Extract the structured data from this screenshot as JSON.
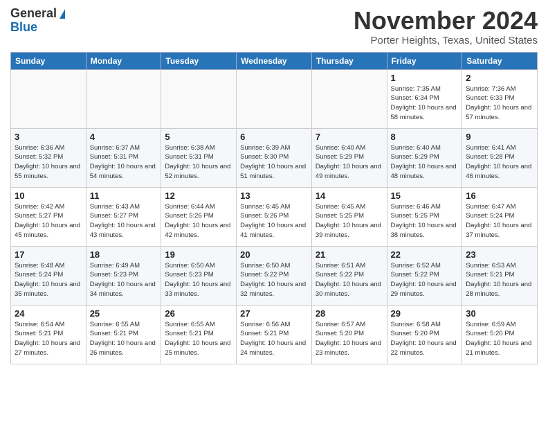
{
  "logo": {
    "general": "General",
    "blue": "Blue"
  },
  "header": {
    "month": "November 2024",
    "location": "Porter Heights, Texas, United States"
  },
  "weekdays": [
    "Sunday",
    "Monday",
    "Tuesday",
    "Wednesday",
    "Thursday",
    "Friday",
    "Saturday"
  ],
  "weeks": [
    [
      {
        "day": "",
        "info": ""
      },
      {
        "day": "",
        "info": ""
      },
      {
        "day": "",
        "info": ""
      },
      {
        "day": "",
        "info": ""
      },
      {
        "day": "",
        "info": ""
      },
      {
        "day": "1",
        "info": "Sunrise: 7:35 AM\nSunset: 6:34 PM\nDaylight: 10 hours and 58 minutes."
      },
      {
        "day": "2",
        "info": "Sunrise: 7:36 AM\nSunset: 6:33 PM\nDaylight: 10 hours and 57 minutes."
      }
    ],
    [
      {
        "day": "3",
        "info": "Sunrise: 6:36 AM\nSunset: 5:32 PM\nDaylight: 10 hours and 55 minutes."
      },
      {
        "day": "4",
        "info": "Sunrise: 6:37 AM\nSunset: 5:31 PM\nDaylight: 10 hours and 54 minutes."
      },
      {
        "day": "5",
        "info": "Sunrise: 6:38 AM\nSunset: 5:31 PM\nDaylight: 10 hours and 52 minutes."
      },
      {
        "day": "6",
        "info": "Sunrise: 6:39 AM\nSunset: 5:30 PM\nDaylight: 10 hours and 51 minutes."
      },
      {
        "day": "7",
        "info": "Sunrise: 6:40 AM\nSunset: 5:29 PM\nDaylight: 10 hours and 49 minutes."
      },
      {
        "day": "8",
        "info": "Sunrise: 6:40 AM\nSunset: 5:29 PM\nDaylight: 10 hours and 48 minutes."
      },
      {
        "day": "9",
        "info": "Sunrise: 6:41 AM\nSunset: 5:28 PM\nDaylight: 10 hours and 46 minutes."
      }
    ],
    [
      {
        "day": "10",
        "info": "Sunrise: 6:42 AM\nSunset: 5:27 PM\nDaylight: 10 hours and 45 minutes."
      },
      {
        "day": "11",
        "info": "Sunrise: 6:43 AM\nSunset: 5:27 PM\nDaylight: 10 hours and 43 minutes."
      },
      {
        "day": "12",
        "info": "Sunrise: 6:44 AM\nSunset: 5:26 PM\nDaylight: 10 hours and 42 minutes."
      },
      {
        "day": "13",
        "info": "Sunrise: 6:45 AM\nSunset: 5:26 PM\nDaylight: 10 hours and 41 minutes."
      },
      {
        "day": "14",
        "info": "Sunrise: 6:45 AM\nSunset: 5:25 PM\nDaylight: 10 hours and 39 minutes."
      },
      {
        "day": "15",
        "info": "Sunrise: 6:46 AM\nSunset: 5:25 PM\nDaylight: 10 hours and 38 minutes."
      },
      {
        "day": "16",
        "info": "Sunrise: 6:47 AM\nSunset: 5:24 PM\nDaylight: 10 hours and 37 minutes."
      }
    ],
    [
      {
        "day": "17",
        "info": "Sunrise: 6:48 AM\nSunset: 5:24 PM\nDaylight: 10 hours and 35 minutes."
      },
      {
        "day": "18",
        "info": "Sunrise: 6:49 AM\nSunset: 5:23 PM\nDaylight: 10 hours and 34 minutes."
      },
      {
        "day": "19",
        "info": "Sunrise: 6:50 AM\nSunset: 5:23 PM\nDaylight: 10 hours and 33 minutes."
      },
      {
        "day": "20",
        "info": "Sunrise: 6:50 AM\nSunset: 5:22 PM\nDaylight: 10 hours and 32 minutes."
      },
      {
        "day": "21",
        "info": "Sunrise: 6:51 AM\nSunset: 5:22 PM\nDaylight: 10 hours and 30 minutes."
      },
      {
        "day": "22",
        "info": "Sunrise: 6:52 AM\nSunset: 5:22 PM\nDaylight: 10 hours and 29 minutes."
      },
      {
        "day": "23",
        "info": "Sunrise: 6:53 AM\nSunset: 5:21 PM\nDaylight: 10 hours and 28 minutes."
      }
    ],
    [
      {
        "day": "24",
        "info": "Sunrise: 6:54 AM\nSunset: 5:21 PM\nDaylight: 10 hours and 27 minutes."
      },
      {
        "day": "25",
        "info": "Sunrise: 6:55 AM\nSunset: 5:21 PM\nDaylight: 10 hours and 26 minutes."
      },
      {
        "day": "26",
        "info": "Sunrise: 6:55 AM\nSunset: 5:21 PM\nDaylight: 10 hours and 25 minutes."
      },
      {
        "day": "27",
        "info": "Sunrise: 6:56 AM\nSunset: 5:21 PM\nDaylight: 10 hours and 24 minutes."
      },
      {
        "day": "28",
        "info": "Sunrise: 6:57 AM\nSunset: 5:20 PM\nDaylight: 10 hours and 23 minutes."
      },
      {
        "day": "29",
        "info": "Sunrise: 6:58 AM\nSunset: 5:20 PM\nDaylight: 10 hours and 22 minutes."
      },
      {
        "day": "30",
        "info": "Sunrise: 6:59 AM\nSunset: 5:20 PM\nDaylight: 10 hours and 21 minutes."
      }
    ]
  ]
}
